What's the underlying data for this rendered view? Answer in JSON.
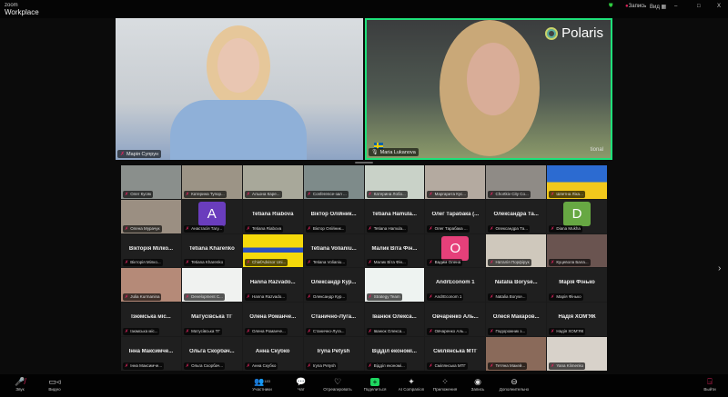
{
  "app": {
    "brand_small": "zoom",
    "brand": "Workplace",
    "recording": "Запись",
    "view": "Вид",
    "minimize": "–",
    "maximize": "□",
    "close": "X"
  },
  "speakers": [
    {
      "name": "Марія Супрун"
    },
    {
      "name": "Maria Lukanova",
      "logo": "Polaris",
      "logo_footer": "tional"
    }
  ],
  "gallery": [
    {
      "type": "video",
      "label": "Олег Кусяк",
      "bg": "#8a8f8c"
    },
    {
      "type": "video",
      "label": "Катерина Тупор...",
      "bg": "#9c9486"
    },
    {
      "type": "video",
      "label": "Альона Каре...",
      "bg": "#a8a89a"
    },
    {
      "type": "video",
      "label": "Conference-зал ...",
      "bg": "#7e8b8a"
    },
    {
      "type": "video",
      "label": "Катерина Лобо...",
      "bg": "#c9d2c8"
    },
    {
      "type": "video",
      "label": "Маргарита Кус...",
      "bg": "#b4aaa0"
    },
    {
      "type": "video",
      "label": "Chortkiv City Co...",
      "bg": "#8f8b86"
    },
    {
      "type": "video",
      "label": "Шпетна Ліка...",
      "bg": "linear-gradient(180deg,#2c6bd1 50%,#f2c81c 50%)"
    },
    {
      "type": "video",
      "label": "Олена Мурачук",
      "bg": "#9b8f82"
    },
    {
      "type": "avatar",
      "letter": "A",
      "color": "#6a3dbd",
      "label": "Анастасія Тагу..."
    },
    {
      "type": "name",
      "name": "Tetiana Riabova",
      "label": "Tetiana Riabova"
    },
    {
      "type": "name",
      "name": "Віктор Олійник...",
      "label": "Віктор Олійник..."
    },
    {
      "type": "name",
      "name": "Tetiana Hamula...",
      "label": "Tetiana Hamula..."
    },
    {
      "type": "name",
      "name": "Олег Тарабака (...",
      "label": "Олег Тарабака ..."
    },
    {
      "type": "name",
      "name": "Олександра Та...",
      "label": "Олександра Та..."
    },
    {
      "type": "avatar",
      "letter": "D",
      "color": "#67a843",
      "label": "Diana Mukha"
    },
    {
      "type": "name",
      "name": "Вікторія Мілко...",
      "label": "Вікторія Мілко..."
    },
    {
      "type": "name",
      "name": "Tetiana Kharenko",
      "label": "Tetiana Kharenko"
    },
    {
      "type": "video",
      "label": "ChiefAdvisor Uni...",
      "bg": "linear-gradient(180deg,#f5d90a 40%,#2a4fc0 40%,#2a4fc0 55%,#f5d90a 55%)"
    },
    {
      "type": "name",
      "name": "Tetiana Volianiu...",
      "label": "Tetiana Volianiu..."
    },
    {
      "type": "name",
      "name": "Малик Віта Фін...",
      "label": "Малик Віта Фін..."
    },
    {
      "type": "avatar",
      "letter": "O",
      "color": "#e6407a",
      "label": "Вадим Олена"
    },
    {
      "type": "video",
      "label": "Наталія Порфірук",
      "bg": "#cfc8bc"
    },
    {
      "type": "video",
      "label": "Куцевола Бала...",
      "bg": "#6a5450"
    },
    {
      "type": "video",
      "label": "Julia Kurmanina",
      "bg": "#b58a78"
    },
    {
      "type": "video",
      "label": "Development C...",
      "bg": "#f0f2f0"
    },
    {
      "type": "name",
      "name": "Hanna Razvado...",
      "label": "Hanna Razvado..."
    },
    {
      "type": "name",
      "name": "Олександр Кур...",
      "label": "Олександр Кур..."
    },
    {
      "type": "video",
      "label": "Strategy Team",
      "bg": "#eef3f1"
    },
    {
      "type": "name",
      "name": "AndrEconom 1",
      "label": "AndrEconom 1"
    },
    {
      "type": "name",
      "name": "Natalia Boryse...",
      "label": "Natalia Boryse..."
    },
    {
      "type": "name",
      "name": "Марія Фінько",
      "label": "Марія Фінько"
    },
    {
      "type": "name",
      "name": "Ізюмська міс...",
      "label": "Ізюмська міс..."
    },
    {
      "type": "name",
      "name": "Матусівська ТГ",
      "label": "Матусівська ТГ"
    },
    {
      "type": "name",
      "name": "Олена Романче...",
      "label": "Олена Романче..."
    },
    {
      "type": "name",
      "name": "Станично-Луга...",
      "label": "Станично-Луга..."
    },
    {
      "type": "name",
      "name": "Іванюк Олекса...",
      "label": "Іванюк Олекса..."
    },
    {
      "type": "name",
      "name": "Овчаренко Аль...",
      "label": "Овчаренко Аль..."
    },
    {
      "type": "name",
      "name": "Олеся Макаров...",
      "label": "Подорожник з..."
    },
    {
      "type": "name",
      "name": "Надія ХОМ'ЯК",
      "label": "Надія ХОМ'ЯК"
    },
    {
      "type": "name",
      "name": "Інна Максимче...",
      "label": "Інна Максимче..."
    },
    {
      "type": "name",
      "name": "Ольга Скорбач...",
      "label": "Ольга Скорбач..."
    },
    {
      "type": "name",
      "name": "Анна Скубко",
      "label": "Анна Скубко"
    },
    {
      "type": "name",
      "name": "Iryna Petysh",
      "label": "Iryna Petysh"
    },
    {
      "type": "name",
      "name": "Відділ економі...",
      "label": "Відділ економі..."
    },
    {
      "type": "name",
      "name": "Смілянська МТГ",
      "label": "Смілянська МТГ"
    },
    {
      "type": "video",
      "label": "Тетяна Макей...",
      "bg": "#8a6a5a"
    },
    {
      "type": "video",
      "label": "Yana Klimenko",
      "bg": "#d8d2ca"
    }
  ],
  "toolbar": {
    "audio": "Звук",
    "video": "Видео",
    "participants": "Участники",
    "participants_count": "183",
    "chat": "Чат",
    "react": "Отреагировать",
    "share": "Поделиться",
    "ai": "AI Companion",
    "apps": "Приложения",
    "record": "Запись",
    "more": "Дополнительно",
    "leave": "Выйти"
  }
}
